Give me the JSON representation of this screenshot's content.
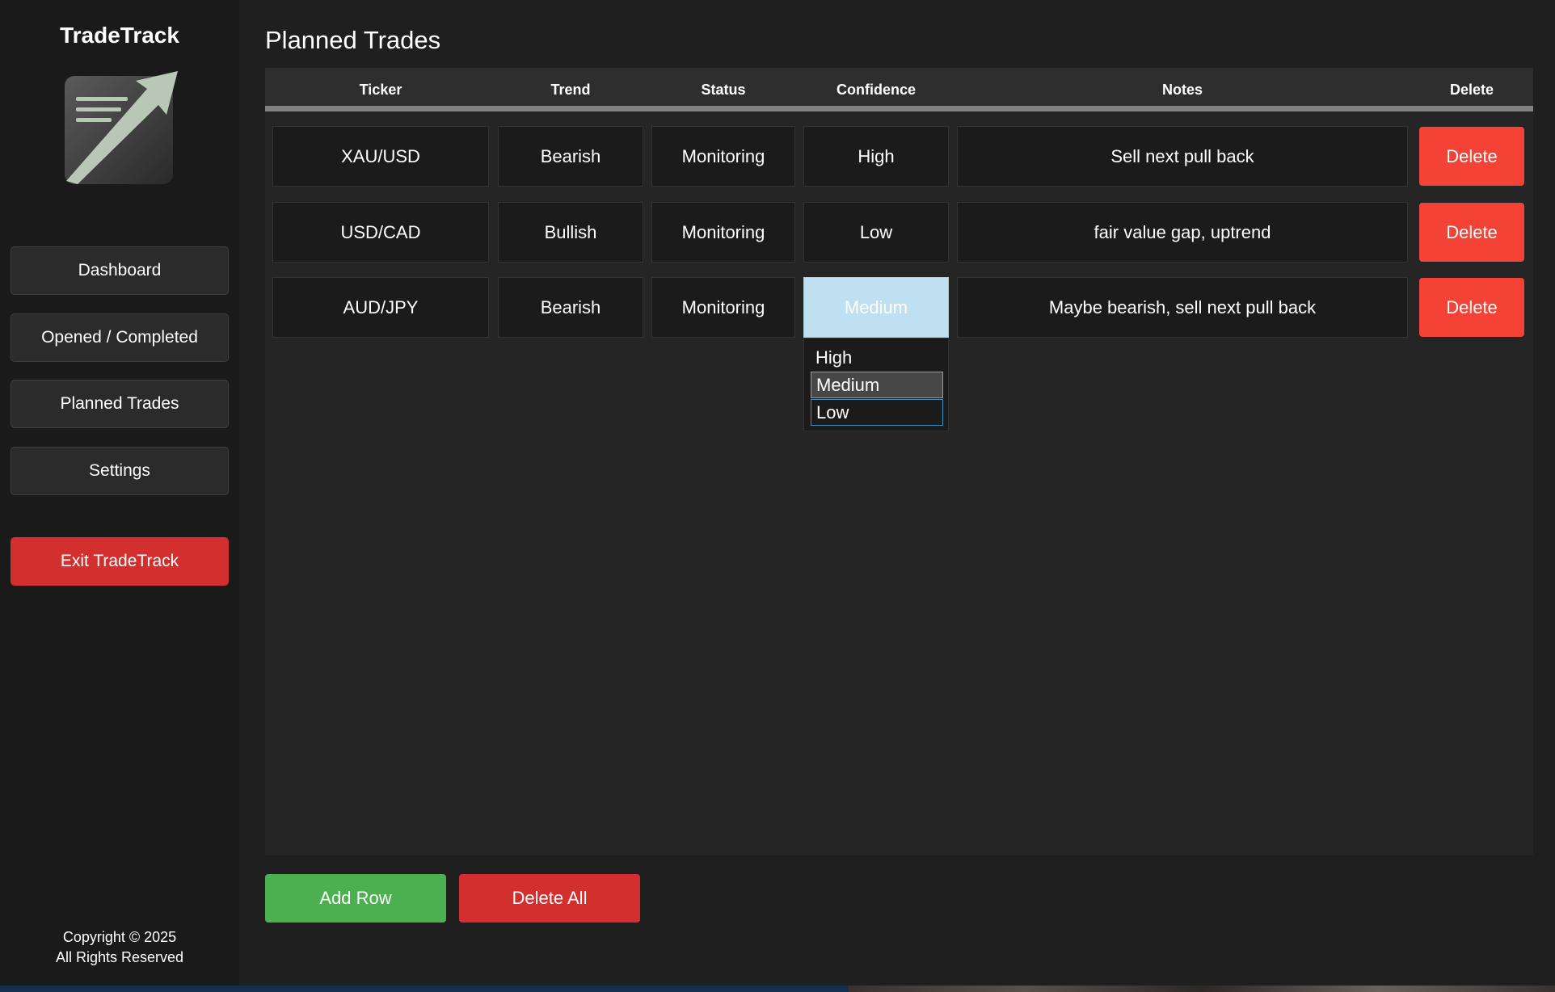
{
  "sidebar": {
    "app_name": "TradeTrack",
    "logo_icon": "trend-up-document-icon",
    "nav": {
      "dashboard": "Dashboard",
      "opened_completed": "Opened / Completed",
      "planned_trades": "Planned Trades",
      "settings": "Settings",
      "exit": "Exit TradeTrack"
    },
    "copyright_line1": "Copyright © 2025",
    "copyright_line2": "All Rights Reserved"
  },
  "main": {
    "title": "Planned Trades",
    "columns": {
      "ticker": "Ticker",
      "trend": "Trend",
      "status": "Status",
      "confidence": "Confidence",
      "notes": "Notes",
      "delete": "Delete"
    },
    "rows": [
      {
        "ticker": "XAU/USD",
        "trend": "Bearish",
        "status": "Monitoring",
        "confidence": "High",
        "notes": "Sell next pull back",
        "delete": "Delete"
      },
      {
        "ticker": "USD/CAD",
        "trend": "Bullish",
        "status": "Monitoring",
        "confidence": "Low",
        "notes": "fair value gap, uptrend",
        "delete": "Delete"
      },
      {
        "ticker": "AUD/JPY",
        "trend": "Bearish",
        "status": "Monitoring",
        "confidence": "Medium",
        "notes": "Maybe bearish, sell next pull back",
        "delete": "Delete"
      }
    ],
    "confidence_dropdown": {
      "options": [
        "High",
        "Medium",
        "Low"
      ],
      "selected": "Medium"
    },
    "buttons": {
      "add_row": "Add Row",
      "delete_all": "Delete All"
    }
  },
  "colors": {
    "background": "#1f1f1f",
    "sidebar": "#1a1a1a",
    "delete_red": "#f44336",
    "exit_red": "#d32f2f",
    "add_green": "#4caf50",
    "active_cell": "#bfe0f1"
  }
}
